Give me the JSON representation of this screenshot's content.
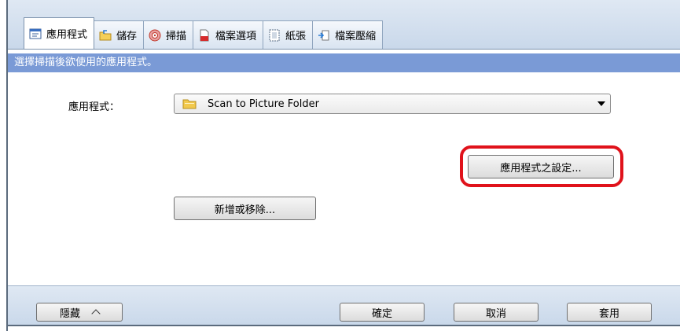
{
  "tabs": [
    {
      "label": "應用程式",
      "icon": "application-icon",
      "active": true
    },
    {
      "label": "儲存",
      "icon": "save-folder-icon"
    },
    {
      "label": "掃描",
      "icon": "scan-icon"
    },
    {
      "label": "檔案選項",
      "icon": "file-option-icon"
    },
    {
      "label": "紙張",
      "icon": "paper-icon"
    },
    {
      "label": "檔案壓縮",
      "icon": "compression-icon"
    }
  ],
  "banner": {
    "text": "選擇掃描後欲使用的應用程式。"
  },
  "application": {
    "label": "應用程式：",
    "selected": "Scan to Picture Folder"
  },
  "buttons": {
    "app_settings": "應用程式之設定...",
    "add_remove": "新增或移除..."
  },
  "footer": {
    "hide": "隱藏",
    "ok": "確定",
    "cancel": "取消",
    "apply": "套用"
  },
  "colors": {
    "banner": "#7a9ad6",
    "highlight": "#e0121b",
    "chrome": "#c9d8ea"
  }
}
